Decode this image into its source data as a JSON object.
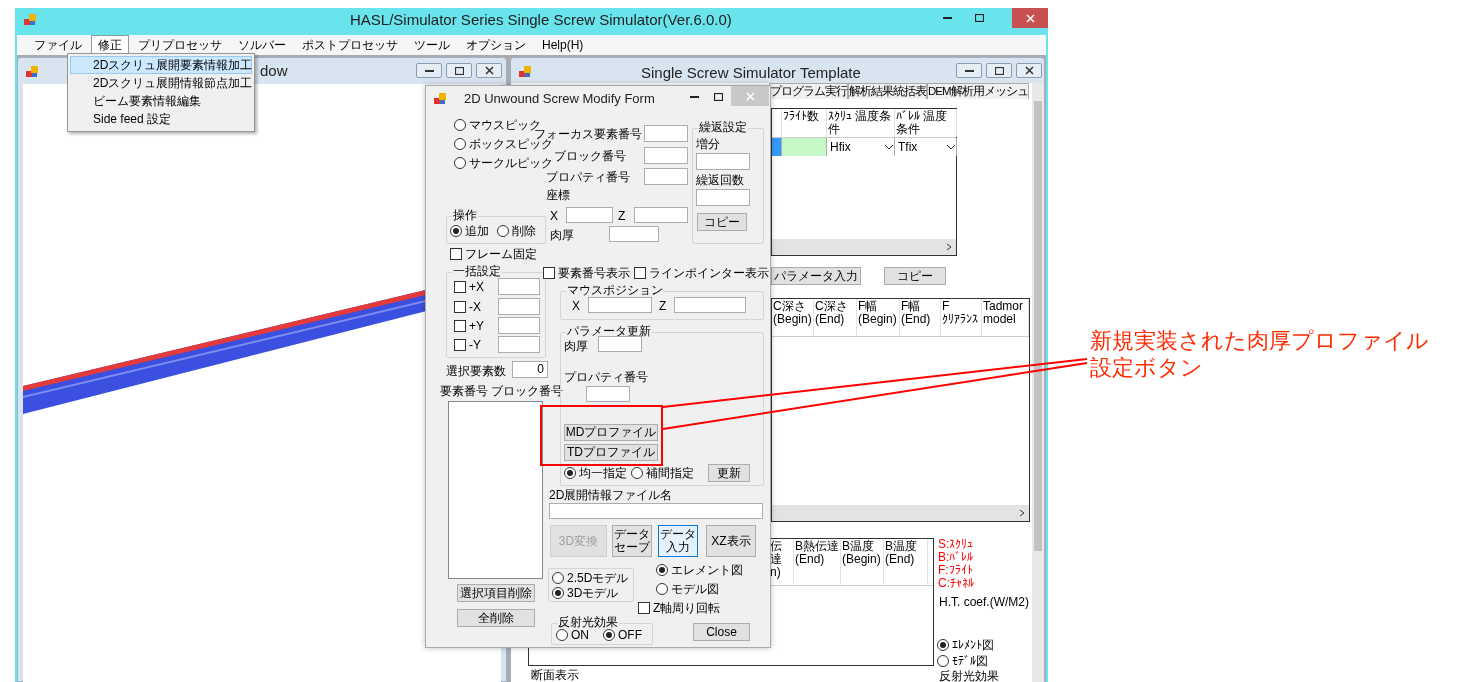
{
  "main_window": {
    "title": "HASL/Simulator Series Single Screw Simulator(Ver.6.0.0)"
  },
  "menu_bar": [
    {
      "label": "ファイル",
      "selected": false
    },
    {
      "label": "修正",
      "selected": true
    },
    {
      "label": "プリプロセッサ",
      "selected": false
    },
    {
      "label": "ソルバー",
      "selected": false
    },
    {
      "label": "ポストプロセッサ",
      "selected": false
    },
    {
      "label": "ツール",
      "selected": false
    },
    {
      "label": "オプション",
      "selected": false
    },
    {
      "label": "Help(H)",
      "selected": false
    }
  ],
  "dropdown_menu": [
    {
      "label": "2Dスクリュ展開要素情報加工",
      "selected": true
    },
    {
      "label": "2Dスクリュ展開情報節点加工",
      "selected": false
    },
    {
      "label": "ビーム要素情報編集",
      "selected": false
    },
    {
      "label": "Side feed 設定",
      "selected": false
    }
  ],
  "left_window": {
    "title": "dow"
  },
  "template_window": {
    "title": "Single Screw Simulator Template",
    "tabs": [
      {
        "label": "プログラム実行",
        "selected": false
      },
      {
        "label": "解析結果統括表",
        "selected": false
      },
      {
        "label": "DEM解析用メッシュ",
        "selected": false
      }
    ],
    "table_1": {
      "columns": [
        "ﾌﾗｲﾄ数",
        "ｽｸﾘｭ 温度条件",
        "ﾊﾞﾚﾙ 温度条件"
      ],
      "row": [
        "Hfix",
        "Tfix"
      ]
    },
    "buttons": [
      "パラメータ入力",
      "コピー"
    ],
    "table_2": {
      "columns": [
        "C深さ (Begin)",
        "C深さ (End)",
        "F幅 (Begin)",
        "F幅 (End)",
        "F ｸﾘｱﾗﾝｽ",
        "Tadmor model"
      ]
    },
    "table_3": {
      "columns": [
        "伝達 n)",
        "B熱伝達 (End)",
        "B温度 (Begin)",
        "B温度 (End)"
      ]
    },
    "legend": [
      "S:ｽｸﾘｭ",
      "B:ﾊﾞﾚﾙ",
      "F:ﾌﾗｲﾄ",
      "C:ﾁｬﾈﾙ"
    ],
    "coef_label": "H.T. coef.(W/M2)",
    "view_options": [
      {
        "label": "ｴﾚﾒﾝﾄ図",
        "selected": true
      },
      {
        "label": "ﾓﾃﾞﾙ図",
        "selected": false
      }
    ],
    "bottom_labels": [
      "断面表示",
      "反射光効果"
    ]
  },
  "form": {
    "title": "2D Unwound Screw Modify Form",
    "pick_modes": [
      {
        "label": "マウスピック",
        "selected": false
      },
      {
        "label": "ボックスピック",
        "selected": false
      },
      {
        "label": "サークルピック",
        "selected": false
      }
    ],
    "element_fields": [
      "フォーカス要素番号",
      "ブロック番号",
      "プロパティ番号"
    ],
    "coord_label": "座標",
    "x_label": "X",
    "z_label": "Z",
    "thickness_label": "肉厚",
    "repeat_group": {
      "title": "繰返設定",
      "increment_label": "増分",
      "count_label": "繰返回数",
      "button": "コピー"
    },
    "operation": {
      "title": "操作",
      "options": [
        {
          "label": "追加",
          "selected": true
        },
        {
          "label": "削除",
          "selected": false
        }
      ]
    },
    "frame_lock": {
      "label": "フレーム固定",
      "checked": false
    },
    "batch": {
      "title": "一括設定",
      "rows": [
        {
          "label": "+X",
          "checked": false
        },
        {
          "label": "-X",
          "checked": false
        },
        {
          "label": "+Y",
          "checked": false
        },
        {
          "label": "-Y",
          "checked": false
        }
      ]
    },
    "selected_count": {
      "label": "選択要素数",
      "value": "0"
    },
    "list_header": "要素番号 ブロック番号",
    "list_buttons": [
      "選択項目削除",
      "全削除"
    ],
    "display_checks": [
      {
        "label": "要素番号表示",
        "checked": false
      },
      {
        "label": "ラインポインター表示",
        "checked": false
      }
    ],
    "mouse_position": {
      "title": "マウスポジション",
      "x_label": "X",
      "z_label": "Z"
    },
    "parameter_update": {
      "title": "パラメータ更新",
      "thickness_label": "肉厚",
      "property_label": "プロパティ番号",
      "profile_buttons": [
        "MDプロファイル",
        "TDプロファイル"
      ],
      "modes": [
        {
          "label": "均一指定",
          "selected": true
        },
        {
          "label": "補間指定",
          "selected": false
        }
      ],
      "update_button": "更新"
    },
    "file_label": "2D展開情報ファイル名",
    "action_buttons": [
      {
        "label": "3D変換",
        "disabled": true,
        "focused": false
      },
      {
        "label": "データセーブ",
        "disabled": false,
        "focused": false
      },
      {
        "label": "データ入力",
        "disabled": false,
        "focused": true
      },
      {
        "label": "XZ表示",
        "disabled": false,
        "focused": false
      }
    ],
    "model_options": [
      {
        "label": "2.5Dモデル",
        "selected": false
      },
      {
        "label": "3Dモデル",
        "selected": true
      }
    ],
    "view_options": [
      {
        "label": "エレメント図",
        "selected": true
      },
      {
        "label": "モデル図",
        "selected": false
      }
    ],
    "z_rotation": {
      "label": "Z軸周り回転",
      "checked": false
    },
    "reflection": {
      "title": "反射光効果",
      "options": [
        {
          "label": "ON",
          "selected": false
        },
        {
          "label": "OFF",
          "selected": true
        }
      ]
    },
    "close_button": "Close"
  },
  "annotation": {
    "text": "新規実装された肉厚プロファイル設定ボタン"
  }
}
